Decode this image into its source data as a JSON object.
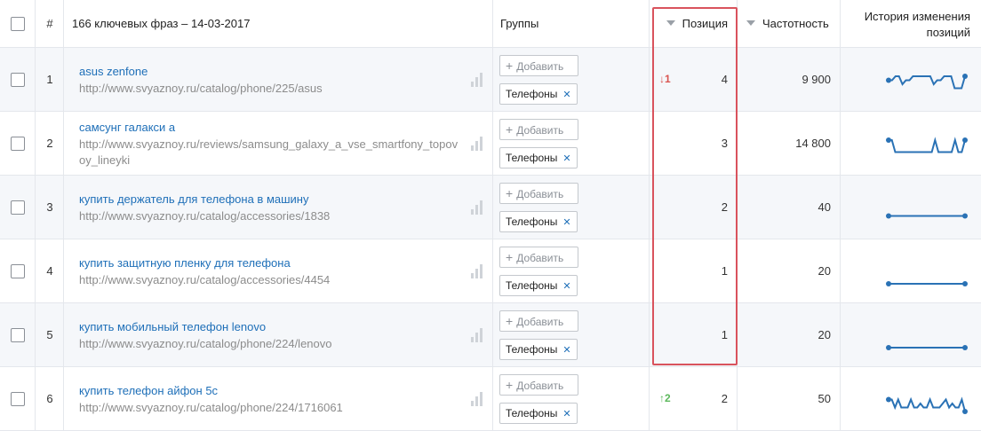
{
  "header": {
    "num_label": "#",
    "phrases_label": "166 ключевых фраз – 14-03-2017",
    "groups_label": "Группы",
    "position_label": "Позиция",
    "frequency_label": "Частотность",
    "history_label_line1": "История изменения",
    "history_label_line2": "позиций"
  },
  "add_label": "Добавить",
  "rows": [
    {
      "num": "1",
      "keyword": "asus zenfone",
      "url": "http://www.svyaznoy.ru/catalog/phone/225/asus",
      "tag": "Телефоны",
      "delta": "1",
      "delta_dir": "down",
      "position": "4",
      "frequency": "9 900",
      "history": [
        4,
        4,
        5,
        5,
        3,
        4,
        4,
        5,
        5,
        5,
        5,
        5,
        5,
        3,
        4,
        4,
        5,
        5,
        5,
        2,
        2,
        2,
        5
      ]
    },
    {
      "num": "2",
      "keyword": "самсунг галакси а",
      "url": "http://www.svyaznoy.ru/reviews/samsung_galaxy_a_vse_smartfony_topovoy_lineyki",
      "tag": "Телефоны",
      "delta": "",
      "delta_dir": "",
      "position": "3",
      "frequency": "14 800",
      "history": [
        5,
        5,
        2,
        2,
        2,
        2,
        2,
        2,
        2,
        2,
        2,
        2,
        2,
        2,
        5,
        2,
        2,
        2,
        2,
        2,
        5,
        2,
        2,
        5
      ]
    },
    {
      "num": "3",
      "keyword": "купить держатель для телефона в машину",
      "url": "http://www.svyaznoy.ru/catalog/accessories/1838",
      "tag": "Телефоны",
      "delta": "",
      "delta_dir": "",
      "position": "2",
      "frequency": "40",
      "history": [
        2,
        2,
        2,
        2,
        2,
        2,
        2,
        2,
        2,
        2,
        2,
        2,
        2,
        2
      ]
    },
    {
      "num": "4",
      "keyword": "купить защитную пленку для телефона",
      "url": "http://www.svyaznoy.ru/catalog/accessories/4454",
      "tag": "Телефоны",
      "delta": "",
      "delta_dir": "",
      "position": "1",
      "frequency": "20",
      "history": [
        1,
        1,
        1,
        1,
        1,
        1,
        1,
        1,
        1,
        1,
        1,
        1,
        1,
        1
      ]
    },
    {
      "num": "5",
      "keyword": "купить мобильный телефон lenovo",
      "url": "http://www.svyaznoy.ru/catalog/phone/224/lenovo",
      "tag": "Телефоны",
      "delta": "",
      "delta_dir": "",
      "position": "1",
      "frequency": "20",
      "history": [
        1,
        1,
        1,
        1,
        1,
        1,
        1,
        1,
        1,
        1,
        1,
        1,
        1,
        1
      ]
    },
    {
      "num": "6",
      "keyword": "купить телефон айфон 5с",
      "url": "http://www.svyaznoy.ru/catalog/phone/224/1716061",
      "tag": "Телефоны",
      "delta": "2",
      "delta_dir": "up",
      "position": "2",
      "frequency": "50",
      "history": [
        4,
        4,
        2,
        4,
        2,
        2,
        2,
        4,
        2,
        2,
        3,
        2,
        2,
        4,
        2,
        2,
        2,
        3,
        4,
        2,
        3,
        2,
        2,
        4,
        1
      ]
    }
  ],
  "colors": {
    "link": "#1e6fb8",
    "url": "#8c8c8c",
    "delta_down": "#d9534f",
    "delta_up": "#5cb85c",
    "highlight": "#d9535d",
    "sparkline": "#2a72b5"
  }
}
